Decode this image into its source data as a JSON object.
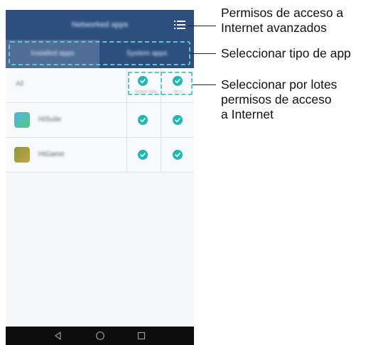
{
  "app": {
    "title": "Networked apps",
    "tabs": [
      {
        "label": "Installed apps",
        "selected": true
      },
      {
        "label": "System apps",
        "selected": false
      }
    ],
    "all_row": {
      "label": "All",
      "columns": [
        "Mobile data",
        "Wi-Fi"
      ]
    },
    "apps": [
      {
        "name": "HiSuite",
        "icon": "app-icon"
      },
      {
        "name": "HiGame",
        "icon": "app-icon"
      }
    ],
    "nav": {
      "back_icon": "back-triangle-icon",
      "home_icon": "home-circle-icon",
      "recent_icon": "recent-square-icon"
    }
  },
  "callouts": {
    "menu_line1": "Permisos de acceso a",
    "menu_line2": "Internet avanzados",
    "tabs": "Seleccionar tipo de app",
    "batch_line1": "Seleccionar por lotes",
    "batch_line2": "permisos de acceso",
    "batch_line3": "a Internet"
  },
  "colors": {
    "appbar": "#2d4f80",
    "tab_selected": "#4f6d97",
    "check": "#1fb8b8",
    "highlight_dash": "#5ec8c8"
  }
}
